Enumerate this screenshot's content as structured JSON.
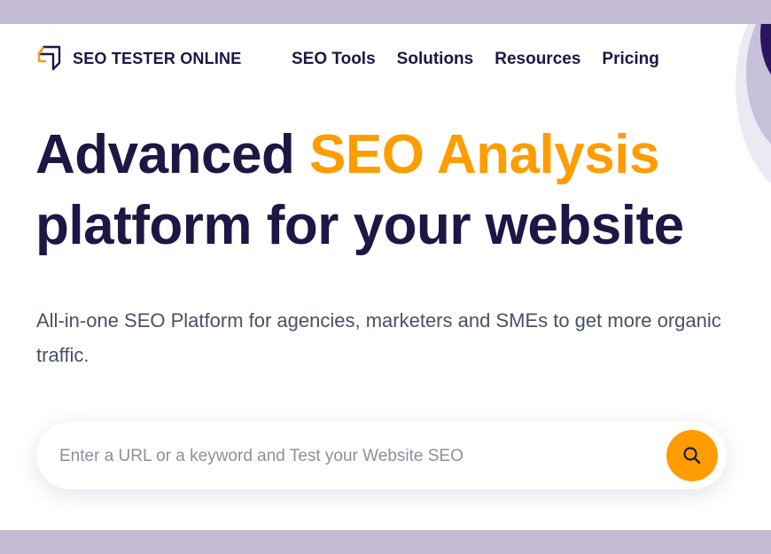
{
  "brand": {
    "name": "SEO TESTER ONLINE",
    "logo_icon": "box-arrow-logo-icon"
  },
  "nav": {
    "items": [
      {
        "label": "SEO Tools"
      },
      {
        "label": "Solutions"
      },
      {
        "label": "Resources"
      },
      {
        "label": "Pricing"
      }
    ]
  },
  "hero": {
    "title_part1": "Advanced ",
    "title_accent": "SEO Analysis",
    "title_part2": "platform for your website",
    "subtitle": "All-in-one SEO Platform for agencies, marketers and SMEs to get more organic traffic."
  },
  "search": {
    "placeholder": "Enter a URL or a keyword and Test your Website SEO",
    "value": "",
    "button_icon": "search-icon"
  },
  "colors": {
    "accent": "#ff9d00",
    "heading": "#1c1745",
    "body_text": "#4b4f66",
    "frame": "#c3bcd2",
    "deco_dark": "#2b1561"
  }
}
